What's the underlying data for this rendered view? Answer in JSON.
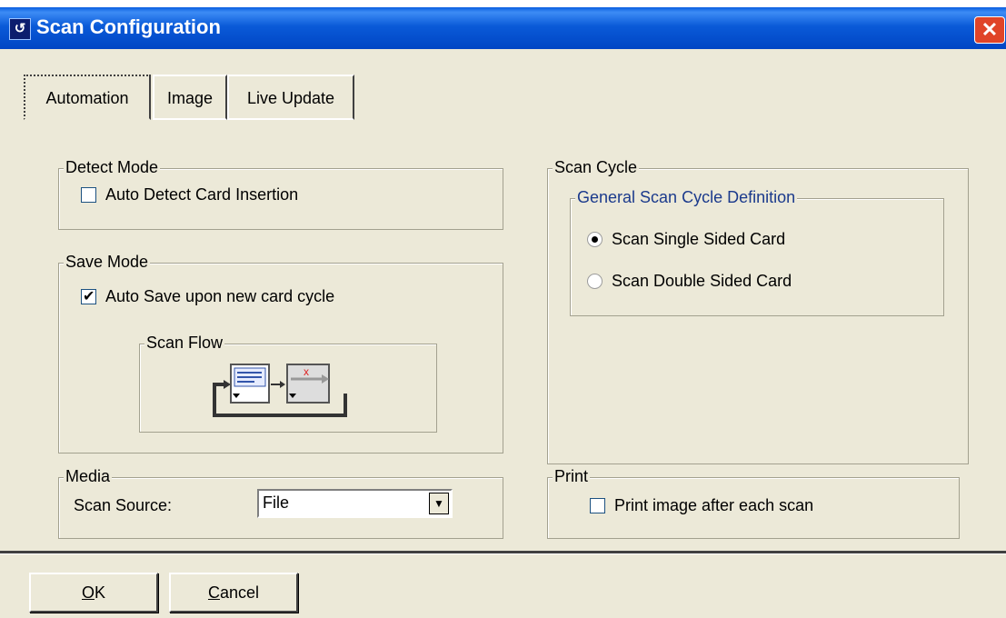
{
  "window": {
    "title": "Scan Configuration"
  },
  "tabs": [
    {
      "label": "Automation",
      "active": true
    },
    {
      "label": "Image",
      "active": false
    },
    {
      "label": "Live Update",
      "active": false
    }
  ],
  "detect_mode": {
    "legend": "Detect Mode",
    "auto_detect_label": "Auto Detect Card Insertion",
    "auto_detect_checked": false
  },
  "save_mode": {
    "legend": "Save Mode",
    "auto_save_label": "Auto Save upon new card cycle",
    "auto_save_checked": true,
    "scan_flow_legend": "Scan Flow"
  },
  "media": {
    "legend": "Media",
    "scan_source_label": "Scan Source:",
    "scan_source_value": "File"
  },
  "scan_cycle": {
    "legend": "Scan Cycle",
    "general_legend": "General Scan Cycle Definition",
    "options": [
      {
        "label": "Scan Single Sided Card",
        "selected": true
      },
      {
        "label": "Scan Double Sided Card",
        "selected": false
      }
    ]
  },
  "print": {
    "legend": "Print",
    "print_after_label": "Print image after each scan",
    "print_after_checked": false
  },
  "buttons": {
    "ok_mnemonic": "O",
    "ok_rest": "K",
    "cancel_mnemonic": "C",
    "cancel_rest": "ancel"
  },
  "colors": {
    "titlebar": "#0054e3",
    "face": "#ece9d8",
    "close": "#e04428",
    "group_text": "#1b3a8c"
  }
}
